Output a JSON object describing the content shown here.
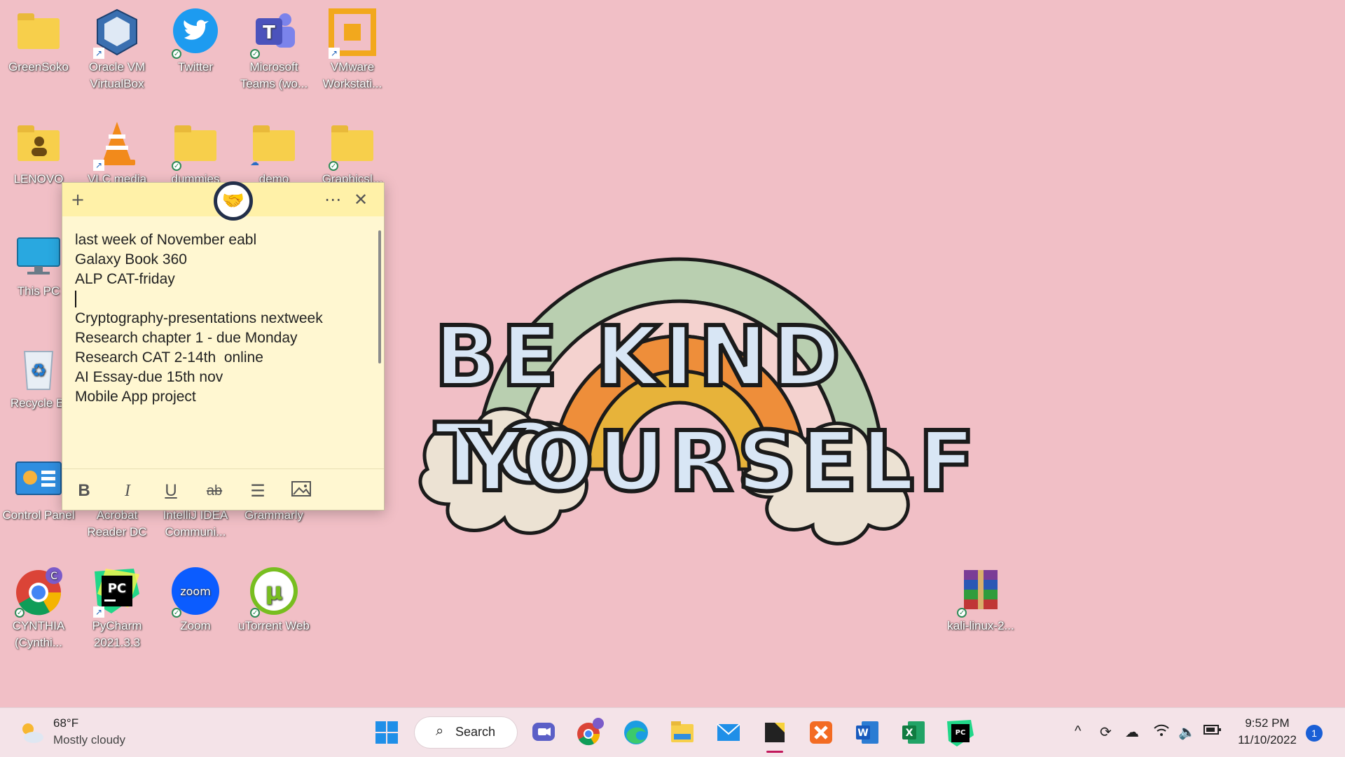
{
  "desktop_icons": [
    {
      "label": "GreenSoko"
    },
    {
      "label": "Oracle VM VirtualBox"
    },
    {
      "label": "Twitter"
    },
    {
      "label": "Microsoft Teams (wo..."
    },
    {
      "label": "VMware Workstati..."
    },
    {
      "label": "LENOVO"
    },
    {
      "label": "VLC media"
    },
    {
      "label": "dummies"
    },
    {
      "label": "demo"
    },
    {
      "label": "Graphics|..."
    },
    {
      "label": "This PC"
    },
    {
      "label": "Recycle Bi"
    },
    {
      "label": "Control Panel"
    },
    {
      "label": "Acrobat Reader DC"
    },
    {
      "label": "IntelliJ IDEA Communi..."
    },
    {
      "label": "Grammarly"
    },
    {
      "label": "CYNTHIA (Cynthi..."
    },
    {
      "label": "PyCharm 2021.3.3"
    },
    {
      "label": "Zoom"
    },
    {
      "label": "uTorrent Web"
    },
    {
      "label": "kali-linux-2..."
    }
  ],
  "sticky_note": {
    "lines": [
      "last week of November eabl",
      "Galaxy Book 360",
      "ALP CAT-friday",
      "",
      "Cryptography-presentations nextweek",
      "Research chapter 1 - due Monday",
      "Research CAT 2-14th  online",
      "AI Essay-due 15th nov",
      "Mobile App project"
    ],
    "toolbar": {
      "bold": "B",
      "italic": "I",
      "underline": "U",
      "strike": "ab"
    }
  },
  "wallpaper_text": {
    "line1": "BE KIND TO",
    "line2": "YOURSELF"
  },
  "taskbar": {
    "weather_temp": "68°F",
    "weather_desc": "Mostly cloudy",
    "search_label": "Search",
    "time": "9:52 PM",
    "date": "11/10/2022",
    "notification_count": "1"
  }
}
